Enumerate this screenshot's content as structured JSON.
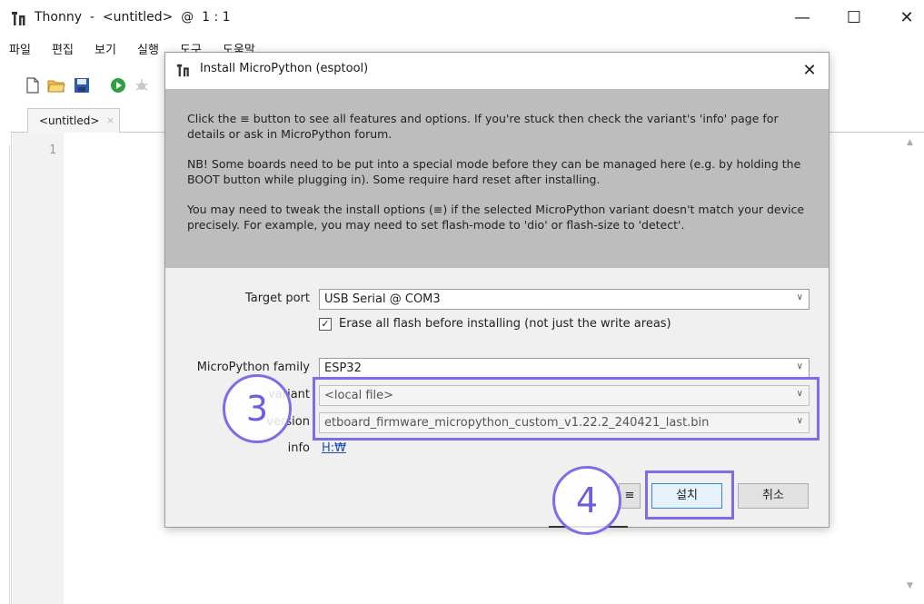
{
  "window": {
    "title": "Thonny  -  <untitled>  @  1 : 1",
    "controls": {
      "minimize": "—",
      "maximize": "☐",
      "close": "✕"
    }
  },
  "menu": {
    "items": [
      {
        "label": "파일"
      },
      {
        "label": "편집"
      },
      {
        "label": "보기"
      },
      {
        "label": "실행"
      },
      {
        "label": "도구"
      },
      {
        "label": "도움말"
      }
    ]
  },
  "toolbar": {
    "icons": [
      "new-file-icon",
      "open-folder-icon",
      "save-icon",
      "run-icon",
      "debug-icon"
    ]
  },
  "editor": {
    "tab_label": "<untitled>",
    "tab_close": "×",
    "line_number": "1"
  },
  "dialog": {
    "title": "Install MicroPython (esptool)",
    "close": "✕",
    "info": [
      "Click the ≡ button to see all features and options. If you're stuck then check the variant's 'info' page for details or ask in MicroPython forum.",
      "NB! Some boards need to be put into a special mode before they can be managed here (e.g. by holding the BOOT button while plugging in). Some require hard reset after installing.",
      "You may need to tweak the install options (≡) if the selected MicroPython variant doesn't match your device precisely. For example, you may need to set flash-mode to 'dio' or flash-size to 'detect'."
    ],
    "target_port": {
      "label": "Target port",
      "value": "USB Serial @ COM3"
    },
    "erase_flash": {
      "checked": true,
      "label": "Erase all flash before installing (not just the write areas)"
    },
    "family": {
      "label": "MicroPython family",
      "value": "ESP32"
    },
    "variant": {
      "label": "variant",
      "value": "<local file>"
    },
    "version": {
      "label": "version",
      "value": "etboard_firmware_micropython_custom_v1.22.2_240421_last.bin"
    },
    "info_row": {
      "label": "info",
      "link": "H:₩"
    },
    "buttons": {
      "menu": "≡",
      "install": "설치",
      "cancel": "취소"
    }
  },
  "annotations": [
    {
      "number": "3"
    },
    {
      "number": "4"
    }
  ],
  "colors": {
    "annotation": "#7b6ee6",
    "info_panel": "#bdbdbd",
    "dialog_bg": "#f0f0f0",
    "link": "#1a4fb3"
  }
}
